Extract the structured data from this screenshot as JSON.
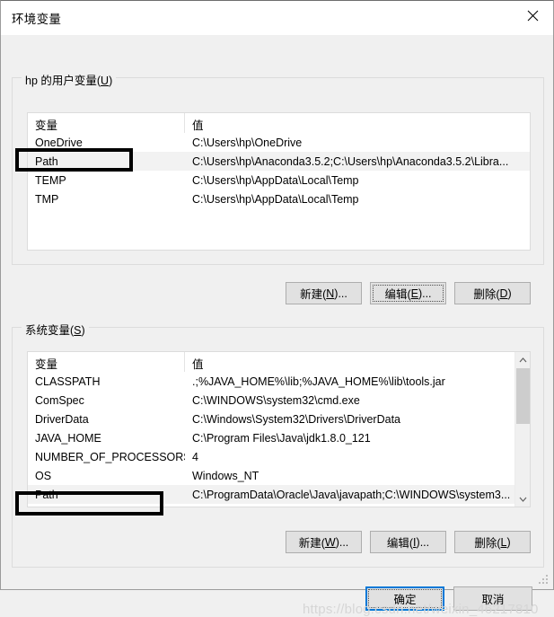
{
  "window": {
    "title": "环境变量",
    "close_icon": "close-icon"
  },
  "user_section": {
    "legend_prefix": "hp 的用户变量(",
    "legend_accel": "U",
    "legend_suffix": ")",
    "columns": [
      "变量",
      "值"
    ],
    "rows": [
      {
        "name": "OneDrive",
        "value": "C:\\Users\\hp\\OneDrive",
        "selected": false
      },
      {
        "name": "Path",
        "value": "C:\\Users\\hp\\Anaconda3.5.2;C:\\Users\\hp\\Anaconda3.5.2\\Libra...",
        "selected": true
      },
      {
        "name": "TEMP",
        "value": "C:\\Users\\hp\\AppData\\Local\\Temp",
        "selected": false
      },
      {
        "name": "TMP",
        "value": "C:\\Users\\hp\\AppData\\Local\\Temp",
        "selected": false
      }
    ],
    "buttons": {
      "new": {
        "prefix": "新建(",
        "accel": "N",
        "suffix": ")..."
      },
      "edit": {
        "prefix": "编辑(",
        "accel": "E",
        "suffix": ")..."
      },
      "delete": {
        "prefix": "删除(",
        "accel": "D",
        "suffix": ")"
      }
    }
  },
  "system_section": {
    "legend_prefix": "系统变量(",
    "legend_accel": "S",
    "legend_suffix": ")",
    "columns": [
      "变量",
      "值"
    ],
    "rows": [
      {
        "name": "CLASSPATH",
        "value": ".;%JAVA_HOME%\\lib;%JAVA_HOME%\\lib\\tools.jar",
        "selected": false
      },
      {
        "name": "ComSpec",
        "value": "C:\\WINDOWS\\system32\\cmd.exe",
        "selected": false
      },
      {
        "name": "DriverData",
        "value": "C:\\Windows\\System32\\Drivers\\DriverData",
        "selected": false
      },
      {
        "name": "JAVA_HOME",
        "value": "C:\\Program Files\\Java\\jdk1.8.0_121",
        "selected": false
      },
      {
        "name": "NUMBER_OF_PROCESSORS",
        "value": "4",
        "selected": false
      },
      {
        "name": "OS",
        "value": "Windows_NT",
        "selected": false
      },
      {
        "name": "Path",
        "value": "C:\\ProgramData\\Oracle\\Java\\javapath;C:\\WINDOWS\\system3...",
        "selected": true
      }
    ],
    "buttons": {
      "new": {
        "prefix": "新建(",
        "accel": "W",
        "suffix": ")..."
      },
      "edit": {
        "prefix": "编辑(",
        "accel": "I",
        "suffix": ")..."
      },
      "delete": {
        "prefix": "删除(",
        "accel": "L",
        "suffix": ")"
      }
    },
    "scrollbar": {
      "up_icon": "chevron-up-icon",
      "down_icon": "chevron-down-icon"
    }
  },
  "dialog_buttons": {
    "ok": "确定",
    "cancel": "取消"
  },
  "watermark": "https://blog.csdn.net/weixin_46217810"
}
